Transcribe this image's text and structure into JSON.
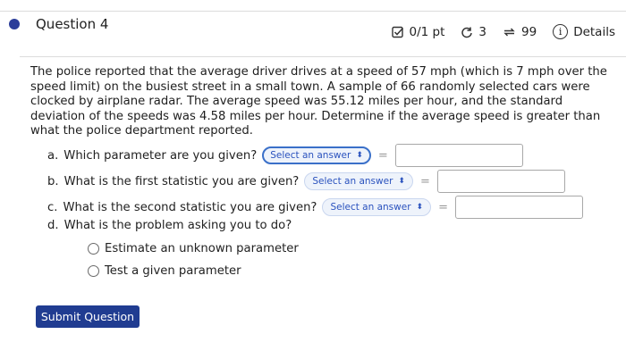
{
  "question": {
    "title": "Question 4"
  },
  "meta": {
    "score": "0/1 pt",
    "retries": "3",
    "attempts": "99",
    "details_label": "Details",
    "details_icon_glyph": "i",
    "score_icon": "checkbox-icon",
    "retries_icon": "redo-icon",
    "attempts_icon": "cycle-icon"
  },
  "problem_text": "The police reported that the average driver drives at a speed of 57 mph (which is 7 mph over the speed limit) on the busiest street in a small town. A sample of 66 randomly selected cars were clocked by airplane radar. The average speed was 55.12 miles per hour, and the standard deviation of the speeds was 4.58 miles per hour. Determine if the average speed is greater than what the police department reported.",
  "parts": {
    "a": {
      "label": "a.",
      "question": "Which parameter are you given?",
      "select_placeholder": "Select an answer",
      "eq": "="
    },
    "b": {
      "label": "b.",
      "question": "What is the first statistic you are given?",
      "select_placeholder": "Select an answer",
      "eq": "="
    },
    "c": {
      "label": "c.",
      "question": "What is the second statistic you are given?",
      "select_placeholder": "Select an answer",
      "eq": "="
    },
    "d": {
      "label": "d.",
      "question": "What is the problem asking you to do?"
    }
  },
  "options": [
    {
      "label": "Estimate an unknown parameter"
    },
    {
      "label": "Test a given parameter"
    }
  ],
  "submit_label": "Submit Question",
  "colors": {
    "accent": "#203c91",
    "dot": "#2c3e9a",
    "select_text": "#2a52be"
  }
}
